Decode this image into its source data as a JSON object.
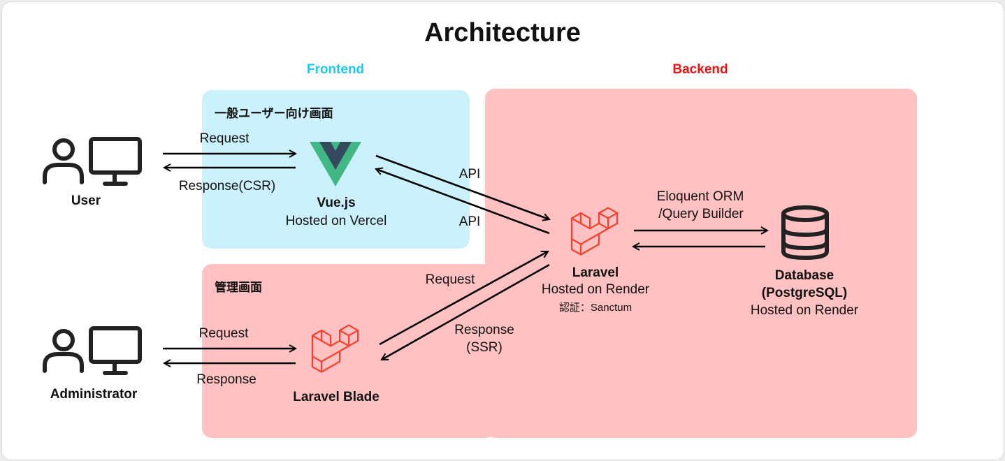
{
  "title": "Architecture",
  "groups": {
    "frontend": "Frontend",
    "backend": "Backend"
  },
  "regions": {
    "user_screen": "一般ユーザー向け画面",
    "admin_screen": "管理画面"
  },
  "nodes": {
    "user": {
      "name": "User"
    },
    "administrator": {
      "name": "Administrator"
    },
    "vue": {
      "name": "Vue.js",
      "host": "Hosted on Vercel"
    },
    "blade": {
      "name": "Laravel Blade"
    },
    "laravel": {
      "name": "Laravel",
      "host": "Hosted on Render",
      "auth": "認証：Sanctum"
    },
    "database": {
      "name_line1": "Database",
      "name_line2": "(PostgreSQL)",
      "host": "Hosted on Render"
    }
  },
  "edges": {
    "user_request": "Request",
    "user_response": "Response(CSR)",
    "vue_api_out": "API",
    "vue_api_in": "API",
    "orm_line1": "Eloquent ORM",
    "orm_line2": "/Query Builder",
    "blade_request": "Request",
    "blade_response_line1": "Response",
    "blade_response_line2": "(SSR)",
    "admin_request": "Request",
    "admin_response": "Response"
  },
  "colors": {
    "frontend_label": "#1ec8f0",
    "backend_label": "#ee1111",
    "frontend_fill": "#cbf2fc",
    "backend_fill": "#ffc1c1",
    "vue_green": "#41b883",
    "vue_dark": "#35495e",
    "laravel_red": "#f4412d"
  }
}
